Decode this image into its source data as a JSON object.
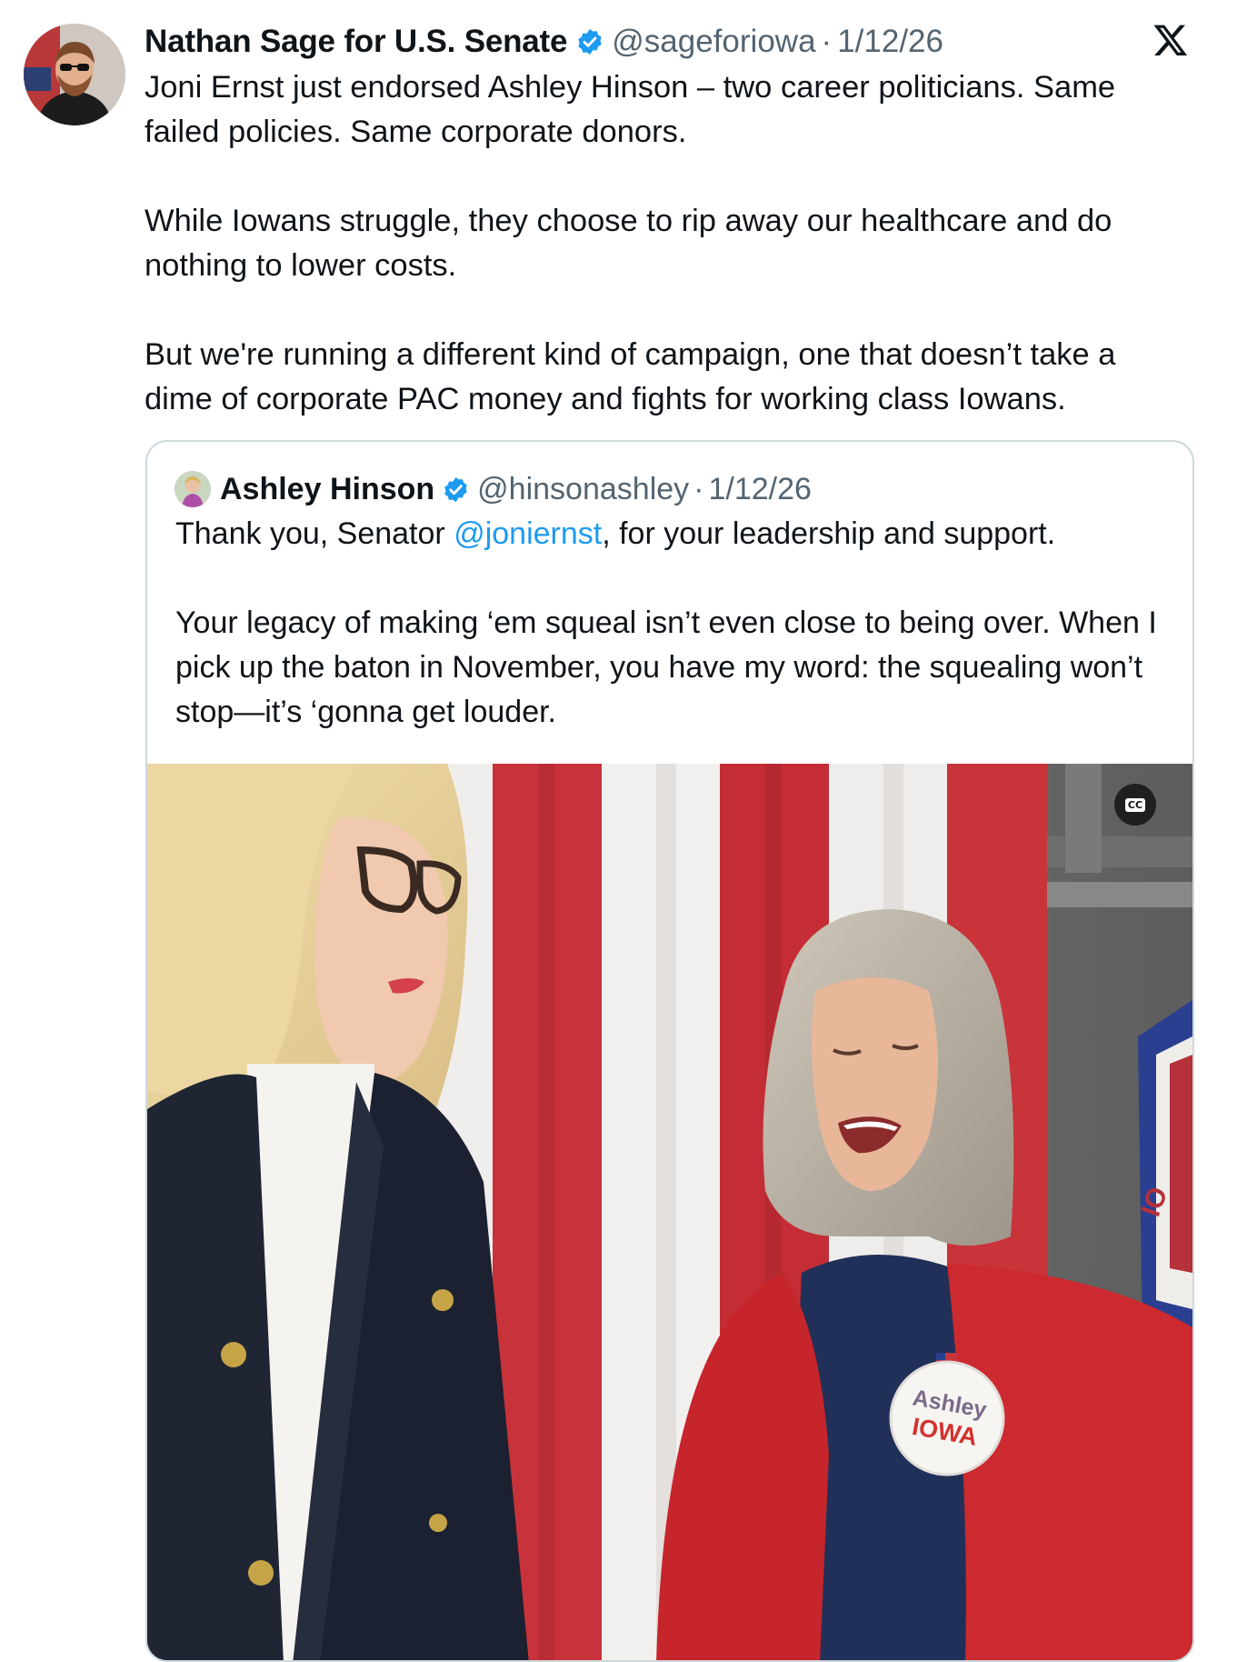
{
  "tweet": {
    "author_name": "Nathan Sage for U.S. Senate",
    "handle": "@sageforiowa",
    "separator": "·",
    "date": "1/12/26",
    "paragraphs": [
      "Joni Ernst just endorsed Ashley Hinson – two career politicians. Same failed policies. Same corporate donors.",
      "While Iowans struggle, they choose to rip away our healthcare and do nothing to lower costs.",
      "But we're running a different kind of campaign, one that doesn’t take a dime of corporate PAC money and fights for working class Iowans."
    ],
    "avatar_icon": "profile-photo",
    "verified_color": "#1d9bf0",
    "platform_icon": "x-logo-icon"
  },
  "quoted": {
    "author_name": "Ashley Hinson",
    "handle": "@hinsonashley",
    "separator": "·",
    "date": "1/12/26",
    "line1_before": "Thank you, Senator ",
    "mention": "@joniernst",
    "line1_after": ", for your leadership and support.",
    "paragraph2": "Your legacy of making ‘em squeal isn’t even close to being over. When I pick up the baton in November, you have my word: the squealing won’t stop—it’s ‘gonna get louder.",
    "mention_color": "#1d9bf0"
  },
  "media": {
    "captions_label": "CC",
    "button_line1": "Ashley",
    "button_line2": "IOWA",
    "flag_fragment": "IO"
  }
}
